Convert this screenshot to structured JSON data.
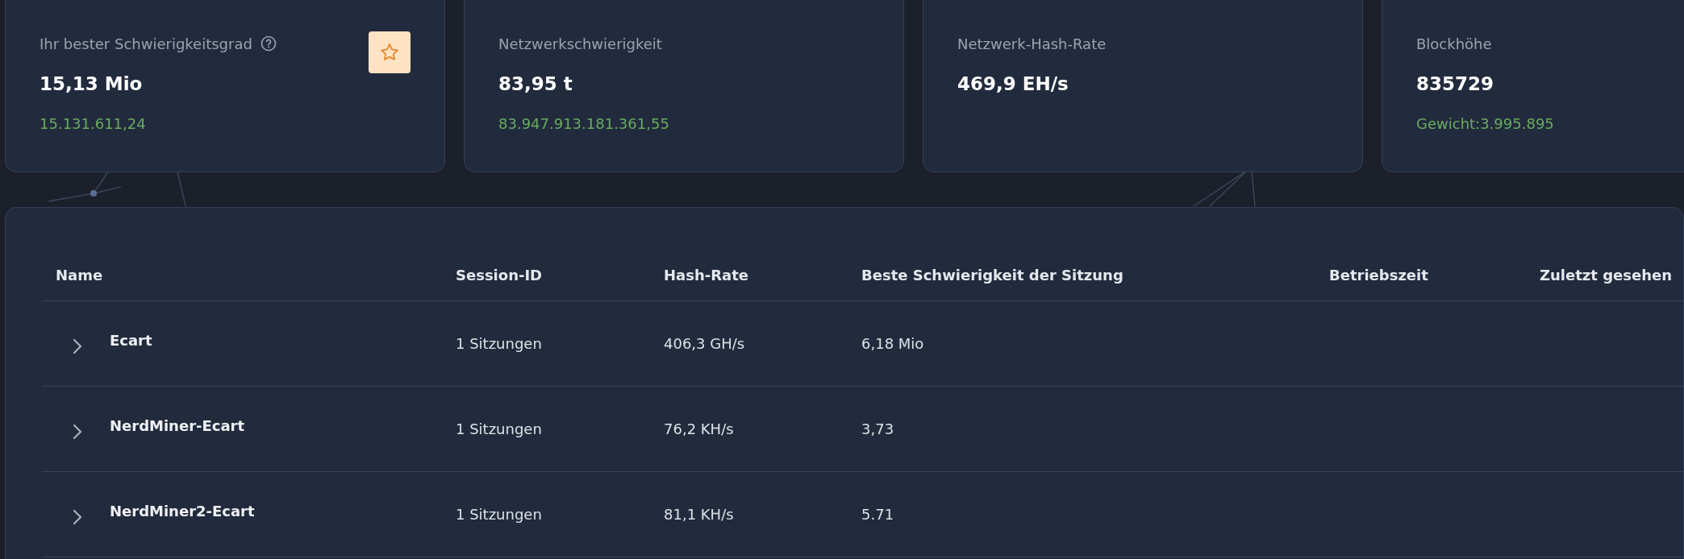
{
  "stats": [
    {
      "label": "Ihr bester Schwierigkeitsgrad",
      "value": "15,13 Mio",
      "detail": "15.131.611,24",
      "help_icon": true,
      "star_button": true
    },
    {
      "label": "Netzwerkschwierigkeit",
      "value": "83,95 t",
      "detail": "83.947.913.181.361,55"
    },
    {
      "label": "Netzwerk-Hash-Rate",
      "value": "469,9 EH/s"
    },
    {
      "label": "Blockhöhe",
      "value": "835729",
      "detail": "Gewicht:3.995.895"
    }
  ],
  "table": {
    "columns": [
      "Name",
      "Session-ID",
      "Hash-Rate",
      "Beste Schwierigkeit der Sitzung",
      "Betriebszeit",
      "Zuletzt gesehen"
    ],
    "rows": [
      {
        "name": "Ecart",
        "sessions": "1 Sitzungen",
        "hash_rate": "406,3 GH/s",
        "best_difficulty": "6,18 Mio",
        "expanded": false
      },
      {
        "name": "NerdMiner-Ecart",
        "sessions": "1 Sitzungen",
        "hash_rate": "76,2 KH/s",
        "best_difficulty": "3,73",
        "expanded": false
      },
      {
        "name": "NerdMiner2-Ecart",
        "sessions": "1 Sitzungen",
        "hash_rate": "81,1 KH/s",
        "best_difficulty": "5.71",
        "expanded": false
      }
    ]
  }
}
